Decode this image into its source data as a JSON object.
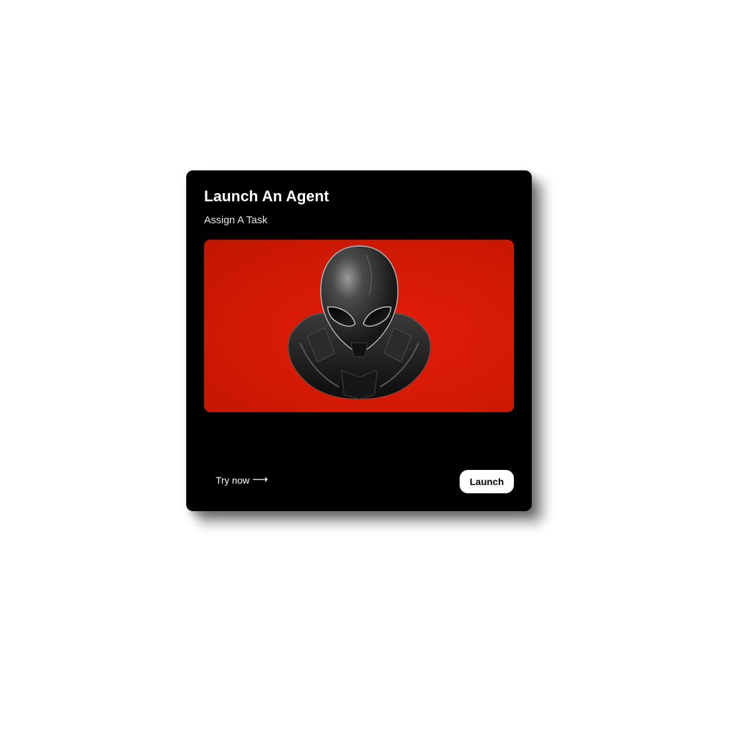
{
  "card": {
    "title": "Launch An Agent",
    "subtitle": "Assign A Task",
    "image": {
      "subject": "alien-helmet-icon",
      "background_color": "#d91b05"
    },
    "footer": {
      "try_label": "Try now",
      "try_arrow": "⟶",
      "launch_label": "Launch"
    }
  },
  "colors": {
    "card_background": "#000000",
    "page_background": "#ffffff",
    "button_background": "#ffffff",
    "accent_red": "#d91b05"
  }
}
